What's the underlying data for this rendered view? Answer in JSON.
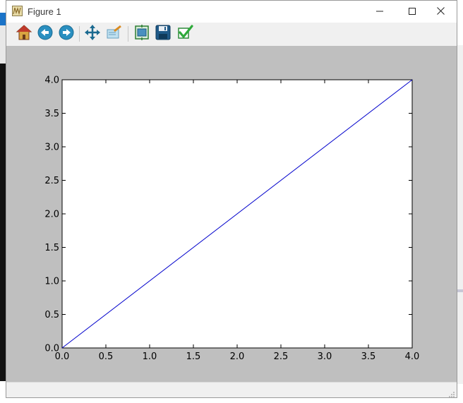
{
  "window": {
    "title": "Figure 1"
  },
  "toolbar": {
    "buttons": [
      {
        "icon": "home-icon"
      },
      {
        "icon": "back-arrow-icon"
      },
      {
        "icon": "forward-arrow-icon"
      },
      {
        "icon": "pan-move-icon"
      },
      {
        "icon": "zoom-rect-icon"
      },
      {
        "icon": "configure-subplots-icon"
      },
      {
        "icon": "save-floppy-icon"
      },
      {
        "icon": "edit-checkmark-icon"
      }
    ]
  },
  "colors": {
    "figure_background": "#bfbfbf",
    "axes_background": "#ffffff",
    "line": "#0000cc"
  },
  "chart_data": {
    "type": "line",
    "x": [
      0,
      4
    ],
    "series": [
      {
        "values": [
          0,
          4
        ]
      }
    ],
    "xlim": [
      0.0,
      4.0
    ],
    "ylim": [
      0.0,
      4.0
    ],
    "xticks": [
      "0.0",
      "0.5",
      "1.0",
      "1.5",
      "2.0",
      "2.5",
      "3.0",
      "3.5",
      "4.0"
    ],
    "yticks": [
      "0.0",
      "0.5",
      "1.0",
      "1.5",
      "2.0",
      "2.5",
      "3.0",
      "3.5",
      "4.0"
    ],
    "grid": false
  }
}
